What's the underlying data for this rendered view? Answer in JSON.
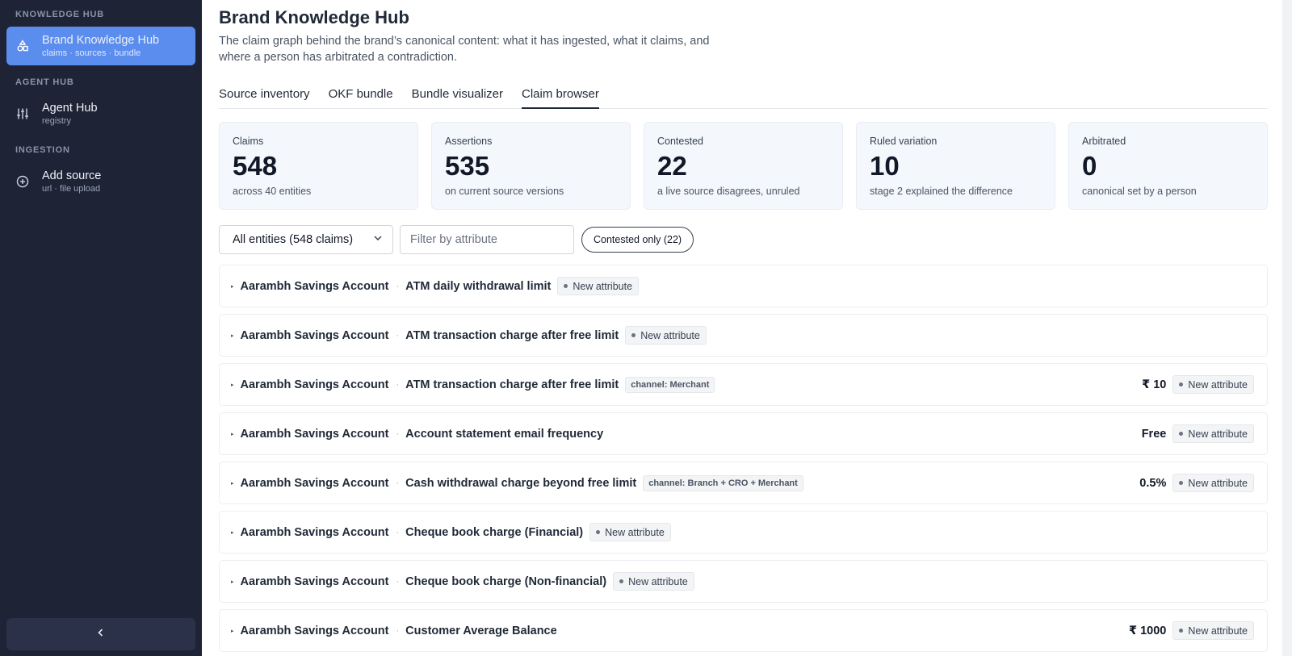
{
  "sidebar": {
    "sections": [
      {
        "label": "KNOWLEDGE HUB",
        "item": {
          "title": "Brand Knowledge Hub",
          "sub": "claims · sources · bundle",
          "icon": "shapes-icon"
        }
      },
      {
        "label": "AGENT HUB",
        "item": {
          "title": "Agent Hub",
          "sub": "registry",
          "icon": "sliders-icon"
        }
      },
      {
        "label": "INGESTION",
        "item": {
          "title": "Add source",
          "sub": "url · file upload",
          "icon": "plus-circle-icon"
        }
      }
    ],
    "collapse_icon": "chevron-left-icon"
  },
  "header": {
    "title": "Brand Knowledge Hub",
    "description": "The claim graph behind the brand’s canonical content: what it has ingested, what it claims, and where a person has arbitrated a contradiction."
  },
  "tabs": [
    {
      "label": "Source inventory"
    },
    {
      "label": "OKF bundle"
    },
    {
      "label": "Bundle visualizer"
    },
    {
      "label": "Claim browser",
      "active": true
    }
  ],
  "stats": [
    {
      "label": "Claims",
      "value": "548",
      "sub": "across 40 entities"
    },
    {
      "label": "Assertions",
      "value": "535",
      "sub": "on current source versions"
    },
    {
      "label": "Contested",
      "value": "22",
      "sub": "a live source disagrees, unruled"
    },
    {
      "label": "Ruled variation",
      "value": "10",
      "sub": "stage 2 explained the difference"
    },
    {
      "label": "Arbitrated",
      "value": "0",
      "sub": "canonical set by a person"
    }
  ],
  "filters": {
    "entity_select": "All entities (548 claims)",
    "attribute_placeholder": "Filter by attribute",
    "contested_button": "Contested only (22)"
  },
  "rows": [
    {
      "entity": "Aarambh Savings Account",
      "attribute": "ATM daily withdrawal limit",
      "qualifier": "",
      "value": "",
      "status": "New attribute"
    },
    {
      "entity": "Aarambh Savings Account",
      "attribute": "ATM transaction charge after free limit",
      "qualifier": "",
      "value": "",
      "status": "New attribute"
    },
    {
      "entity": "Aarambh Savings Account",
      "attribute": "ATM transaction charge after free limit",
      "qualifier": "channel: Merchant",
      "value": "₹ 10",
      "status": "New attribute"
    },
    {
      "entity": "Aarambh Savings Account",
      "attribute": "Account statement email frequency",
      "qualifier": "",
      "value": "Free",
      "status": "New attribute"
    },
    {
      "entity": "Aarambh Savings Account",
      "attribute": "Cash withdrawal charge beyond free limit",
      "qualifier": "channel: Branch + CRO + Merchant",
      "value": "0.5%",
      "status": "New attribute"
    },
    {
      "entity": "Aarambh Savings Account",
      "attribute": "Cheque book charge (Financial)",
      "qualifier": "",
      "value": "",
      "status": "New attribute"
    },
    {
      "entity": "Aarambh Savings Account",
      "attribute": "Cheque book charge (Non-financial)",
      "qualifier": "",
      "value": "",
      "status": "New attribute"
    },
    {
      "entity": "Aarambh Savings Account",
      "attribute": "Customer Average Balance",
      "qualifier": "",
      "value": "₹ 1000",
      "status": "New attribute"
    }
  ],
  "colors": {
    "sidebar_bg": "#1e2436",
    "accent": "#5b8def"
  }
}
